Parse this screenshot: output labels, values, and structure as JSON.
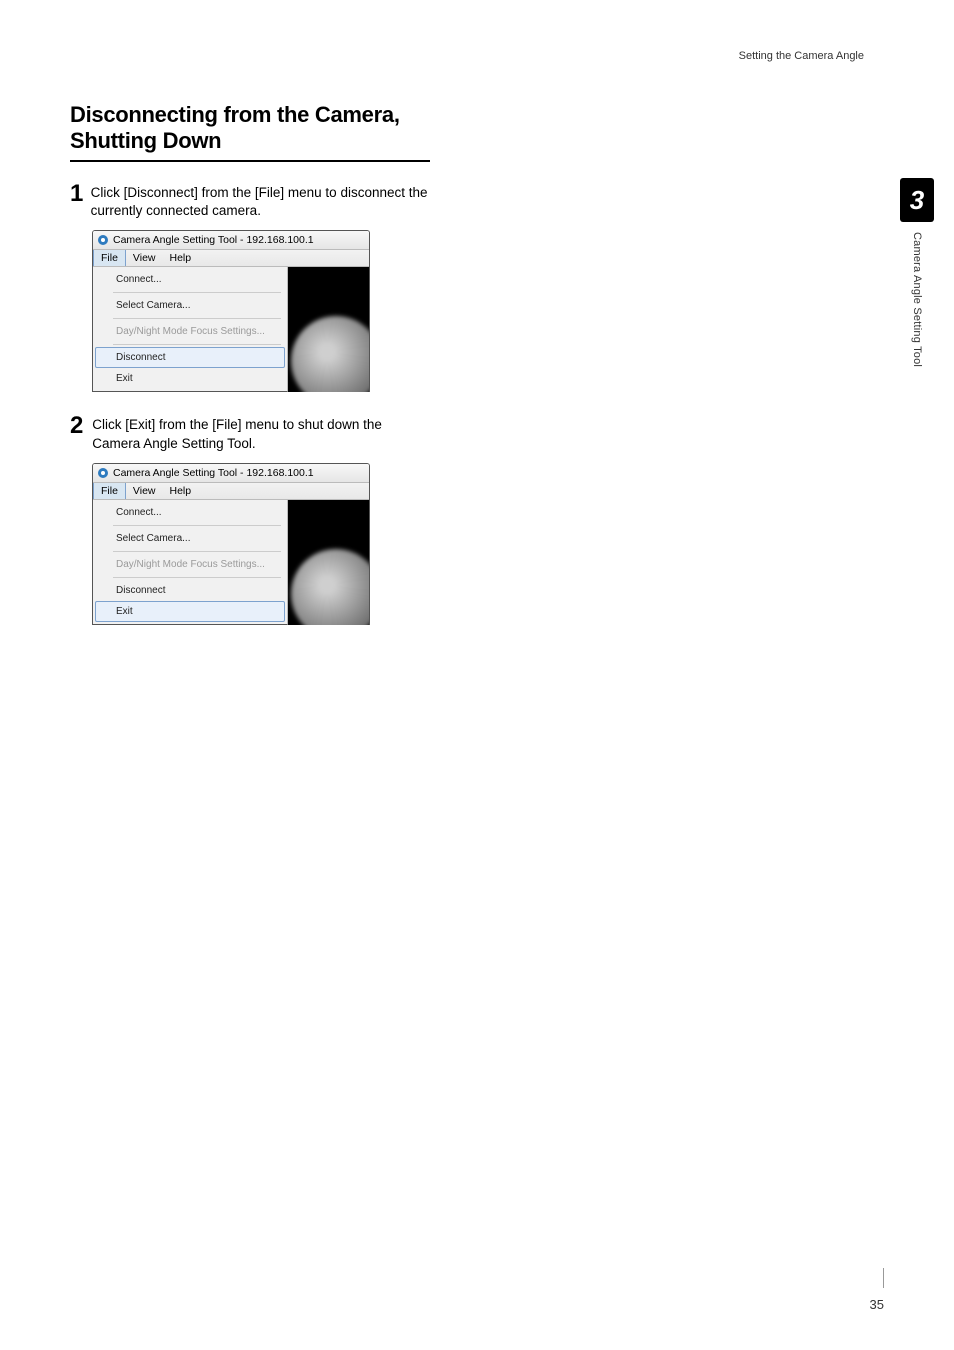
{
  "header": {
    "breadcrumb": "Setting the Camera Angle"
  },
  "title": "Disconnecting from the Camera, Shutting Down",
  "steps": [
    {
      "num": "1",
      "text": "Click [Disconnect] from the [File] menu to disconnect the currently connected camera."
    },
    {
      "num": "2",
      "text": "Click [Exit] from the [File] menu to shut down the Camera Angle Setting Tool."
    }
  ],
  "screenshot": {
    "window_title": "Camera Angle Setting Tool - 192.168.100.1",
    "menubar": {
      "file": "File",
      "view": "View",
      "help": "Help"
    },
    "menu_items": {
      "connect": "Connect...",
      "select_camera": "Select Camera...",
      "day_night": "Day/Night Mode Focus Settings...",
      "disconnect": "Disconnect",
      "exit": "Exit"
    }
  },
  "side": {
    "chapter": "3",
    "label": "Camera Angle Setting Tool"
  },
  "page_number": "35"
}
